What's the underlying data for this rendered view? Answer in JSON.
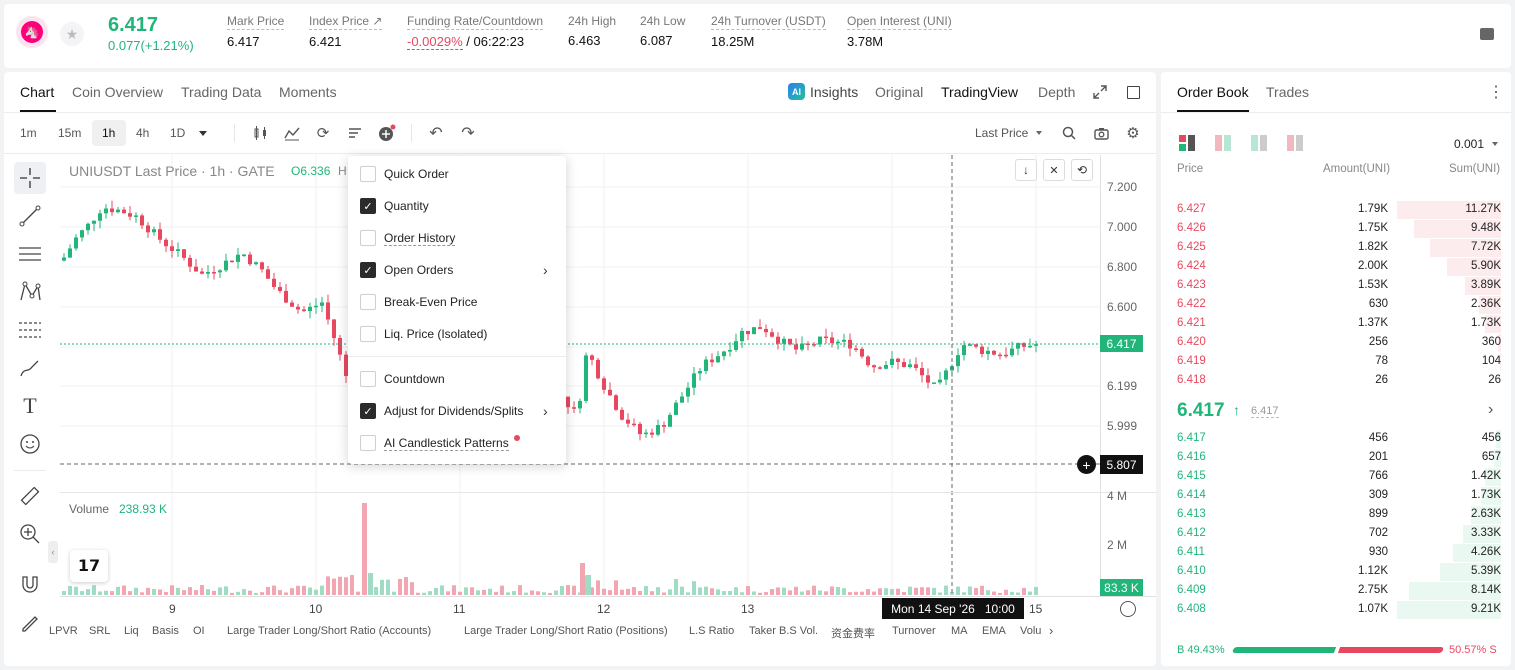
{
  "ticker": {
    "price": "6.417",
    "change": "0.077(+1.21%)",
    "stats": [
      {
        "label": "Mark Price",
        "value": "6.417"
      },
      {
        "label": "Index Price ↗",
        "value": "6.421"
      },
      {
        "label": "Funding Rate/Countdown",
        "value_neg": "-0.0029%",
        "value": " / 06:22:23"
      },
      {
        "label": "24h High",
        "value": "6.463"
      },
      {
        "label": "24h Low",
        "value": "6.087"
      },
      {
        "label": "24h Turnover (USDT)",
        "value": "18.25M"
      },
      {
        "label": "Open Interest (UNI)",
        "value": "3.78M"
      }
    ]
  },
  "chart_tabs": [
    "Chart",
    "Coin Overview",
    "Trading Data",
    "Moments"
  ],
  "view_tabs": [
    "Insights",
    "Original",
    "TradingView",
    "Depth"
  ],
  "timeframes": [
    "1m",
    "15m",
    "1h",
    "4h",
    "1D"
  ],
  "price_type": "Last Price",
  "legend": {
    "symbol": "UNIUSDT Last Price · 1h · GATE",
    "open": "O6.336",
    "h": "H"
  },
  "volume": {
    "label": "Volume",
    "value": "238.93 K",
    "tag": "83.3 K"
  },
  "price_tags": {
    "last": "6.417",
    "crosshair": "5.807"
  },
  "crosshair_time": "Mon 14 Sep '26   10:00",
  "menu": {
    "items": [
      {
        "label": "Quick Order",
        "checked": false
      },
      {
        "label": "Quantity",
        "checked": true
      },
      {
        "label": "Order History",
        "checked": false
      },
      {
        "label": "Open Orders",
        "checked": true
      },
      {
        "label": "Break-Even Price",
        "checked": false
      },
      {
        "label": "Liq. Price (Isolated)",
        "checked": false
      },
      {
        "label": "Countdown",
        "checked": false
      },
      {
        "label": "Adjust for Dividends/Splits",
        "checked": true
      },
      {
        "label": "AI Candlestick Patterns",
        "checked": false
      }
    ]
  },
  "indicators": [
    "LPVR",
    "SRL",
    "Liq",
    "Basis",
    "OI",
    "Large Trader Long/Short Ratio (Accounts)",
    "Large Trader Long/Short Ratio (Positions)",
    "L.S Ratio",
    "Taker B.S Vol.",
    "资金费率",
    "Turnover",
    "MA",
    "EMA",
    "Volu"
  ],
  "orderbook": {
    "tabs": [
      "Order Book",
      "Trades"
    ],
    "precision": "0.001",
    "headers": [
      "Price",
      "Amount(UNI)",
      "Sum(UNI)"
    ],
    "asks": [
      {
        "price": "6.427",
        "amount": "1.79K",
        "sum": "11.27K",
        "depth": 1.0
      },
      {
        "price": "6.426",
        "amount": "1.75K",
        "sum": "9.48K",
        "depth": 0.84
      },
      {
        "price": "6.425",
        "amount": "1.82K",
        "sum": "7.72K",
        "depth": 0.685
      },
      {
        "price": "6.424",
        "amount": "2.00K",
        "sum": "5.90K",
        "depth": 0.523
      },
      {
        "price": "6.423",
        "amount": "1.53K",
        "sum": "3.89K",
        "depth": 0.345
      },
      {
        "price": "6.422",
        "amount": "630",
        "sum": "2.36K",
        "depth": 0.209
      },
      {
        "price": "6.421",
        "amount": "1.37K",
        "sum": "1.73K",
        "depth": 0.153
      },
      {
        "price": "6.420",
        "amount": "256",
        "sum": "360",
        "depth": 0.032
      },
      {
        "price": "6.419",
        "amount": "78",
        "sum": "104",
        "depth": 0.009
      },
      {
        "price": "6.418",
        "amount": "26",
        "sum": "26",
        "depth": 0.002
      }
    ],
    "mid_price": "6.417",
    "mid_mark": "6.417",
    "bids": [
      {
        "price": "6.417",
        "amount": "456",
        "sum": "456",
        "depth": 0.05
      },
      {
        "price": "6.416",
        "amount": "201",
        "sum": "657",
        "depth": 0.071
      },
      {
        "price": "6.415",
        "amount": "766",
        "sum": "1.42K",
        "depth": 0.154
      },
      {
        "price": "6.414",
        "amount": "309",
        "sum": "1.73K",
        "depth": 0.188
      },
      {
        "price": "6.413",
        "amount": "899",
        "sum": "2.63K",
        "depth": 0.285
      },
      {
        "price": "6.412",
        "amount": "702",
        "sum": "3.33K",
        "depth": 0.361
      },
      {
        "price": "6.411",
        "amount": "930",
        "sum": "4.26K",
        "depth": 0.462
      },
      {
        "price": "6.410",
        "amount": "1.12K",
        "sum": "5.39K",
        "depth": 0.585
      },
      {
        "price": "6.409",
        "amount": "2.75K",
        "sum": "8.14K",
        "depth": 0.883
      },
      {
        "price": "6.408",
        "amount": "1.07K",
        "sum": "9.21K",
        "depth": 1.0
      }
    ],
    "buy_ratio": "B 49.43%",
    "sell_ratio": "50.57% S",
    "buy_pct": 49.43
  },
  "colors": {
    "up": "#21b57a",
    "down": "#e8485f",
    "up_bar": "#e9f8f1",
    "down_bar": "#fdecee"
  },
  "chart_data": {
    "type": "candlestick",
    "y_axis_ticks": [
      "7.200",
      "7.000",
      "6.800",
      "6.600",
      "6.199",
      "5.999"
    ],
    "volume_axis_ticks": [
      "4 M",
      "2 M"
    ],
    "x_axis_ticks": [
      "9",
      "10",
      "11",
      "12",
      "13",
      "15"
    ],
    "ylim": [
      5.75,
      7.3
    ]
  }
}
